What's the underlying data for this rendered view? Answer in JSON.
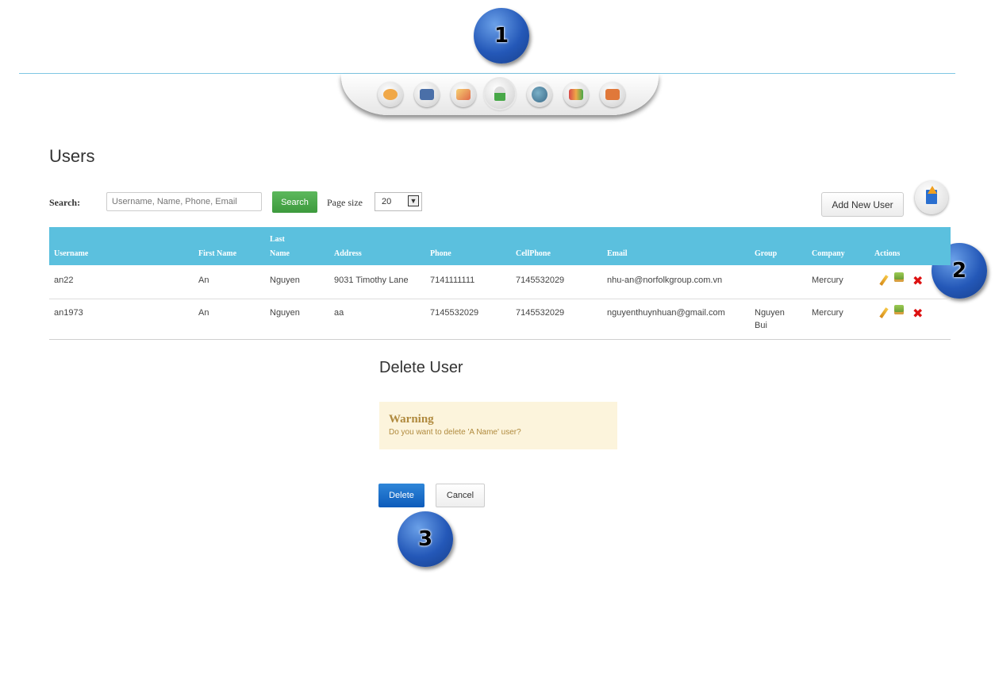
{
  "badges": [
    "1",
    "2",
    "3"
  ],
  "dock": {
    "icons": [
      {
        "name": "chat-icon",
        "color": "#f0a848"
      },
      {
        "name": "vehicle-icon",
        "color": "#4a6fa8"
      },
      {
        "name": "map-photo-icon",
        "color": "#e06a4a"
      },
      {
        "name": "user-icon",
        "color": "#48a848",
        "active": true
      },
      {
        "name": "globe-icon",
        "color": "#4a7a9a"
      },
      {
        "name": "group-icon",
        "color": "#d84a4a"
      },
      {
        "name": "bus-icon",
        "color": "#e0783a"
      }
    ]
  },
  "page": {
    "title": "Users"
  },
  "toolbar": {
    "search_label": "Search:",
    "search_placeholder": "Username, Name, Phone, Email",
    "search_button": "Search",
    "page_size_label": "Page size",
    "page_size_value": "20",
    "add_user_button": "Add New User"
  },
  "table": {
    "headers": {
      "username": "Username",
      "first_name": "First Name",
      "last_name_1": "Last",
      "last_name_2": "Name",
      "address": "Address",
      "phone": "Phone",
      "cellphone": "CellPhone",
      "email": "Email",
      "group": "Group",
      "company": "Company",
      "actions": "Actions"
    },
    "rows": [
      {
        "username": "an22",
        "first_name": "An",
        "last_name": "Nguyen",
        "address": "9031 Timothy Lane",
        "phone": "7141111111",
        "cellphone": "7145532029",
        "email": "nhu-an@norfolkgroup.com.vn",
        "group_1": "",
        "group_2": "",
        "company": "Mercury"
      },
      {
        "username": "an1973",
        "first_name": "An",
        "last_name": "Nguyen",
        "address": "aa",
        "phone": "7145532029",
        "cellphone": "7145532029",
        "email": "nguyenthuynhuan@gmail.com",
        "group_1": "Nguyen",
        "group_2": "Bui",
        "company": "Mercury"
      }
    ],
    "delete_glyph": "✖"
  },
  "dialog": {
    "title": "Delete User",
    "warning_title": "Warning",
    "warning_text": "Do you want to delete 'A Name' user?",
    "delete_button": "Delete",
    "cancel_button": "Cancel"
  },
  "colors": {
    "header_bg": "#5bc0de",
    "search_btn": "#4cae4c",
    "delete_btn": "#0d5bbb",
    "warning_bg": "#fcf4dc",
    "warning_text": "#b08a3e",
    "badge": "#2458b8"
  }
}
